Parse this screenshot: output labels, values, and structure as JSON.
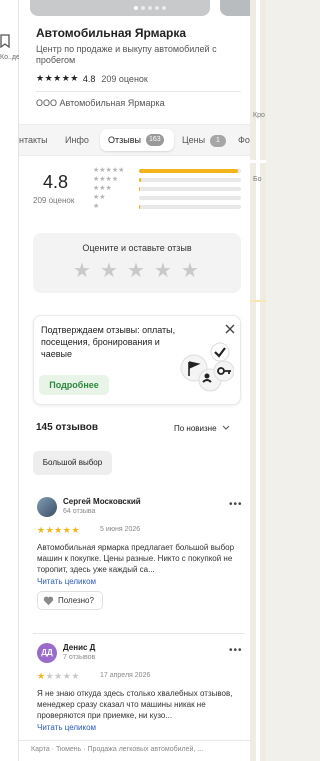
{
  "left_strip": {
    "label": "Ко..де"
  },
  "map": {
    "label_1": "Кро",
    "label_2": "Бо"
  },
  "header": {
    "title": "Автомобильная Ярмарка",
    "subtitle": "Центр по продаже и выкупу автомобилей с пробегом",
    "rating_stars": "★★★★★",
    "rating_value": "4.8",
    "rating_count": "209 оценок",
    "org_name": "ООО Автомобильная Ярмарка",
    "photo_count_dots": 5
  },
  "tabs": {
    "contacts": "нтакты",
    "info": "Инфо",
    "reviews": "Отзывы",
    "reviews_badge": "163",
    "prices": "Цены",
    "prices_badge": "1",
    "photos": "Фо"
  },
  "rating_summary": {
    "value": "4.8",
    "count": "209 оценок",
    "distribution": [
      {
        "stars": "★★★★★",
        "fraction": 0.97
      },
      {
        "stars": "★★★★",
        "fraction": 0.02
      },
      {
        "stars": "★★★",
        "fraction": 0.01
      },
      {
        "stars": "★★",
        "fraction": 0.0
      },
      {
        "stars": "★",
        "fraction": 0.01
      }
    ]
  },
  "rate_box": {
    "title": "Оцените и оставьте отзыв",
    "stars": [
      "★",
      "★",
      "★",
      "★",
      "★"
    ]
  },
  "promo": {
    "text": "Подтверждаем отзывы: оплаты, посещения, бронирования и чаевые",
    "button": "Подробнее"
  },
  "reviews": {
    "count": "145 отзывов",
    "sort": "По новизне",
    "chip": "Большой выбор",
    "items": [
      {
        "name": "Сергей Московский",
        "sub": "64 отзыва",
        "stars": "★★★★★",
        "rating": 5,
        "date": "5 июня 2026",
        "text": "Автомобильная ярмарка предлагает большой выбор машин к покупке. Цены разные. Никто с покупкой не торопит, здесь уже каждый са...",
        "more": "Читать целиком",
        "helpful": "Полезно?",
        "menu": "•••"
      },
      {
        "name": "Денис Д",
        "initials": "ДД",
        "sub": "7 отзывов",
        "stars": "★★★★★",
        "rating": 1,
        "date": "17 апреля 2026",
        "text": "Я не знаю откуда здесь столько хвалебных отзывов, менеджер сразу сказал что машины никак не проверяются при приемке, ни кузо...",
        "more": "Читать целиком",
        "menu": "•••"
      }
    ]
  },
  "footer": {
    "breadcrumbs": "Карта · Тюмень · Продажа легковых автомобилей, ..."
  },
  "colors": {
    "star": "#f3b41a",
    "star_muted": "#c9c9c9",
    "link": "#2a5ab8",
    "promo_green": "#2c8a3c"
  }
}
